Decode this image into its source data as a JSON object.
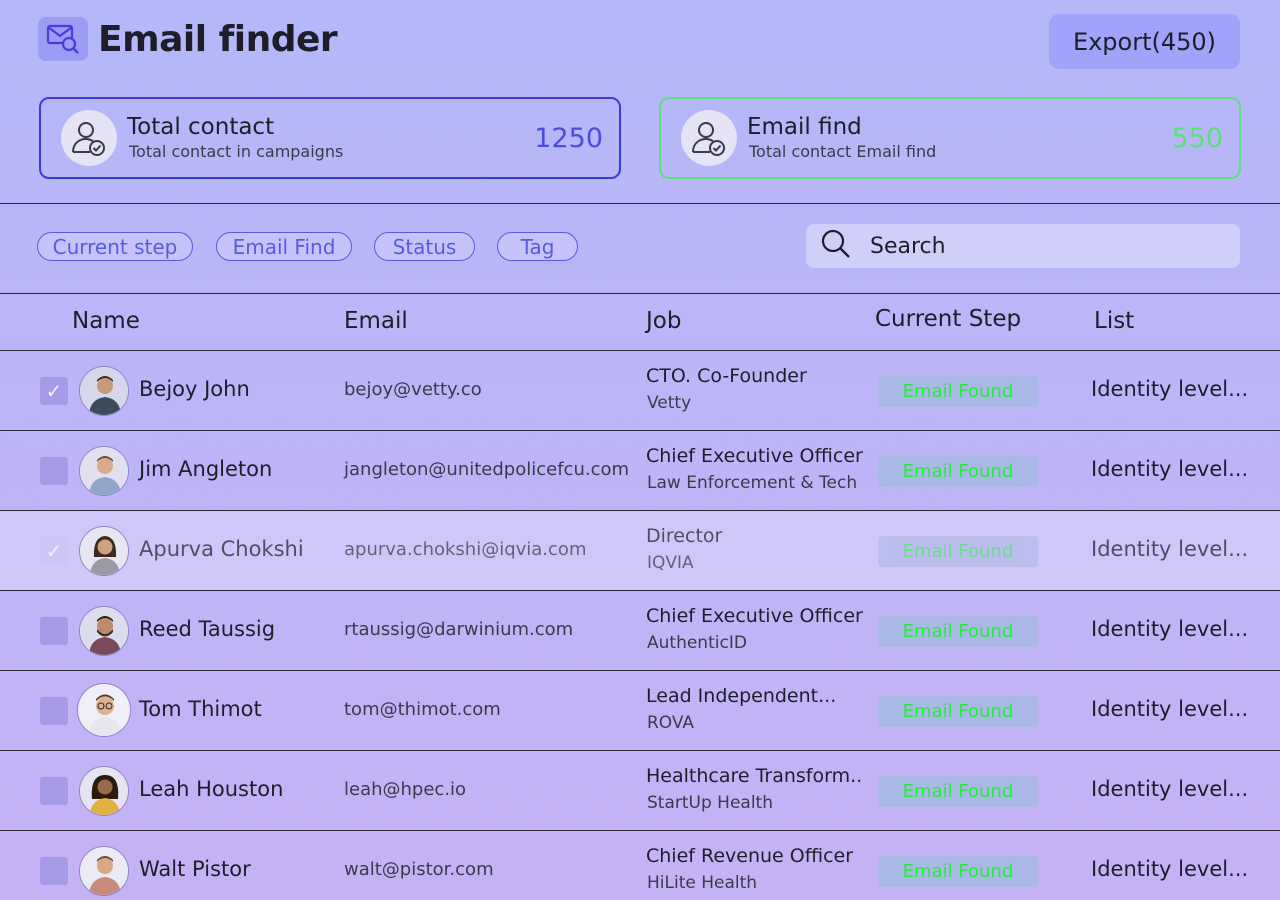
{
  "header": {
    "title": "Email finder",
    "export_label": "Export(450)"
  },
  "stats": [
    {
      "title": "Total contact",
      "subtitle": "Total contact in campaigns",
      "value": "1250",
      "color": "#4b4be0"
    },
    {
      "title": "Email find",
      "subtitle": "Total contact Email find",
      "value": "550",
      "color": "#5ae07a"
    }
  ],
  "filters": [
    "Current step",
    "Email Find",
    "Status",
    "Tag"
  ],
  "search": {
    "placeholder": "Search"
  },
  "columns": [
    "Name",
    "Email",
    "Job",
    "Current Step",
    "List"
  ],
  "rows": [
    {
      "name": "Bejoy John",
      "email": "bejoy@vetty.co",
      "job": "CTO. Co-Founder",
      "company": "Vetty",
      "step": "Email Found",
      "list": "Identity level...",
      "checked": true
    },
    {
      "name": "Jim Angleton",
      "email": "jangleton@unitedpolicefcu.com",
      "job": "Chief Executive Officer",
      "company": "Law Enforcement & Tech",
      "step": "Email Found",
      "list": "Identity level...",
      "checked": false
    },
    {
      "name": "Apurva Chokshi",
      "email": "apurva.chokshi@iqvia.com",
      "job": "Director",
      "company": "IQVIA",
      "step": "Email Found",
      "list": "Identity level...",
      "checked": true,
      "highlight": true
    },
    {
      "name": "Reed Taussig",
      "email": "rtaussig@darwinium.com",
      "job": "Chief Executive Officer",
      "company": "AuthenticID",
      "step": "Email Found",
      "list": "Identity level...",
      "checked": false
    },
    {
      "name": "Tom Thimot",
      "email": "tom@thimot.com",
      "job": "Lead Independent...",
      "company": "ROVA",
      "step": "Email Found",
      "list": "Identity level...",
      "checked": false
    },
    {
      "name": "Leah Houston",
      "email": "leah@hpec.io",
      "job": "Healthcare Transform..",
      "company": "StartUp Health",
      "step": "Email Found",
      "list": "Identity level...",
      "checked": false
    },
    {
      "name": "Walt Pistor",
      "email": "walt@pistor.com",
      "job": "Chief Revenue Officer",
      "company": "HiLite Health",
      "step": "Email Found",
      "list": "Identity level...",
      "checked": false
    }
  ],
  "colors": {
    "accent": "#5a5ae0",
    "status_text": "#1fee3b",
    "status_bg": "#a9b8e4"
  }
}
